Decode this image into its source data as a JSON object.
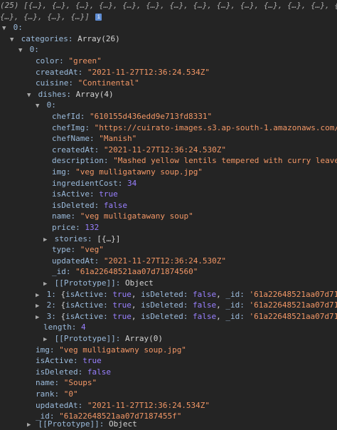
{
  "summary": {
    "line1": "(25) [{…}, {…}, {…}, {…}, {…}, {…}, {…}, {…}, {…}, {…}, {…}, {…}, {…}, {…}, {…},",
    "line2": "{…}, {…}, {…}, {…}]",
    "info": "i"
  },
  "root_index": "0:",
  "categories": {
    "key": "categories:",
    "type": "Array(26)",
    "index": "0:",
    "color": {
      "key": "color:",
      "value": "\"green\""
    },
    "createdAt": {
      "key": "createdAt:",
      "value": "\"2021-11-27T12:36:24.534Z\""
    },
    "cuisine": {
      "key": "cuisine:",
      "value": "\"Continental\""
    },
    "dishes": {
      "key": "dishes:",
      "type": "Array(4)",
      "index": "0:",
      "item0": {
        "chefId": {
          "key": "chefId:",
          "value": "\"610155d436edd9e713fd8331\""
        },
        "chefImg": {
          "key": "chefImg:",
          "value": "\"https://cuirato-images.s3.ap-south-1.amazonaws.com/di"
        },
        "chefName": {
          "key": "chefName:",
          "value": "\"Manish\""
        },
        "createdAt": {
          "key": "createdAt:",
          "value": "\"2021-11-27T12:36:24.530Z\""
        },
        "description": {
          "key": "description:",
          "value": "\"Mashed yellow lentils tempered with curry leaves"
        },
        "img": {
          "key": "img:",
          "value": "\"veg mulligatawny soup.jpg\""
        },
        "ingredientCost": {
          "key": "ingredientCost:",
          "value": "34"
        },
        "isActive": {
          "key": "isActive:",
          "value": "true"
        },
        "isDeleted": {
          "key": "isDeleted:",
          "value": "false"
        },
        "name": {
          "key": "name:",
          "value": "\"veg mulligatawany soup\""
        },
        "price": {
          "key": "price:",
          "value": "132"
        },
        "stories": {
          "key": "stories:",
          "value": "[{…}]"
        },
        "type": {
          "key": "type:",
          "value": "\"veg\""
        },
        "updatedAt": {
          "key": "updatedAt:",
          "value": "\"2021-11-27T12:36:24.530Z\""
        },
        "_id": {
          "key": "_id:",
          "value": "\"61a22648521aa07d71874560\""
        },
        "prototype": {
          "key": "[[Prototype]]:",
          "value": "Object"
        }
      },
      "collapsed": [
        {
          "index": "1:",
          "open": "{",
          "k1": "isActive:",
          "v1": "true",
          "k2": "isDeleted:",
          "v2": "false",
          "k3": "_id:",
          "v3": "'61a22648521aa07d71874"
        },
        {
          "index": "2:",
          "open": "{",
          "k1": "isActive:",
          "v1": "true",
          "k2": "isDeleted:",
          "v2": "false",
          "k3": "_id:",
          "v3": "'61a22648521aa07d71874"
        },
        {
          "index": "3:",
          "open": "{",
          "k1": "isActive:",
          "v1": "true",
          "k2": "isDeleted:",
          "v2": "false",
          "k3": "_id:",
          "v3": "'61a22648521aa07d71874"
        }
      ],
      "length": {
        "key": "length:",
        "value": "4"
      },
      "prototype": {
        "key": "[[Prototype]]:",
        "value": "Array(0)"
      }
    },
    "img": {
      "key": "img:",
      "value": "\"veg mulligatawny soup.jpg\""
    },
    "isActive": {
      "key": "isActive:",
      "value": "true"
    },
    "isDeleted": {
      "key": "isDeleted:",
      "value": "false"
    },
    "name": {
      "key": "name:",
      "value": "\"Soups\""
    },
    "rank": {
      "key": "rank:",
      "value": "\"0\""
    },
    "updatedAt": {
      "key": "updatedAt:",
      "value": "\"2021-11-27T12:36:24.534Z\""
    },
    "_id": {
      "key": "_id:",
      "value": "\"61a22648521aa07d7187455f\""
    },
    "prototype": {
      "key": "[[Prototype]]:",
      "value": "Object"
    }
  },
  "colors": {
    "background": "#242424",
    "key": "#9bbbdc",
    "string": "#f29766",
    "number": "#9980ff",
    "text": "#d4d4d4"
  }
}
